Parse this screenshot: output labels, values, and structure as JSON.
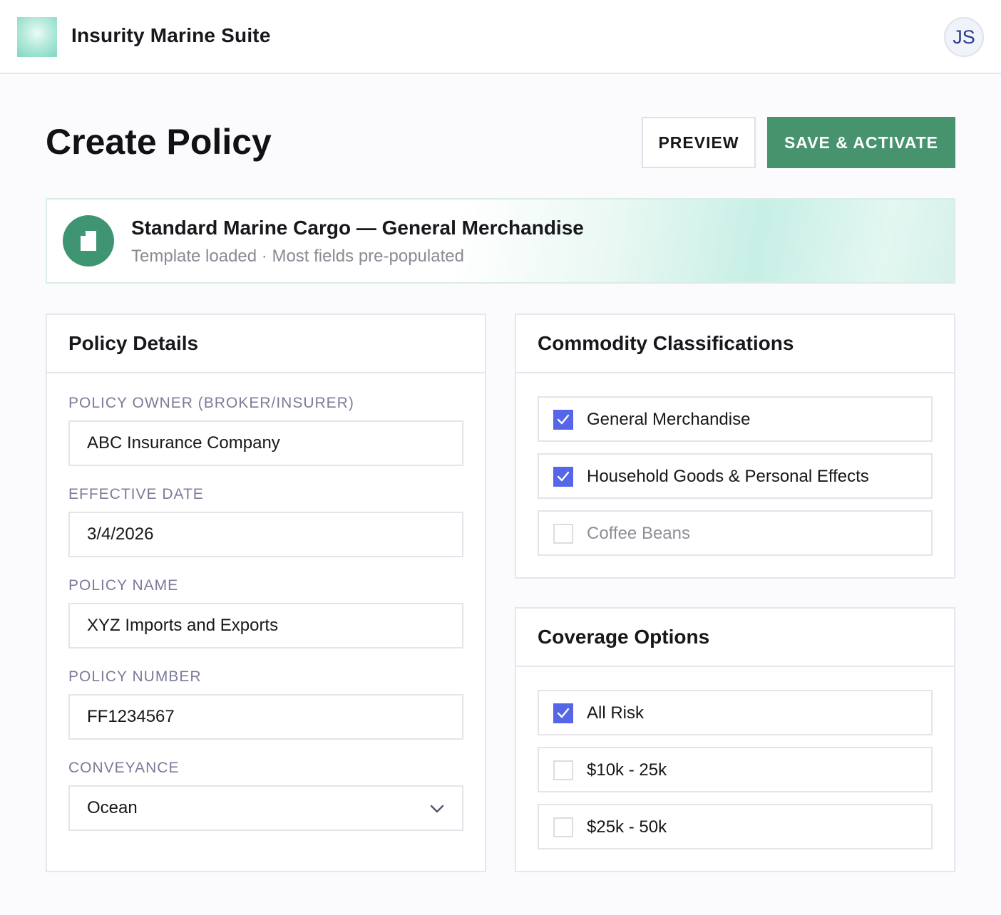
{
  "app": {
    "title": "Insurity Marine Suite",
    "user_initials": "JS"
  },
  "page": {
    "title": "Create Policy",
    "preview_label": "PREVIEW",
    "save_label": "SAVE & ACTIVATE"
  },
  "banner": {
    "title": "Standard Marine Cargo — General Merchandise",
    "subtitle": "Template loaded · Most fields pre-populated",
    "icon": "document-icon"
  },
  "policy_details": {
    "title": "Policy Details",
    "fields": [
      {
        "label": "POLICY OWNER (BROKER/INSURER)",
        "value": "ABC Insurance Company"
      },
      {
        "label": "EFFECTIVE DATE",
        "value": "3/4/2026"
      },
      {
        "label": "POLICY NAME",
        "value": "XYZ Imports and Exports"
      },
      {
        "label": "POLICY NUMBER",
        "value": "FF1234567"
      },
      {
        "label": "CONVEYANCE",
        "value": "Ocean"
      }
    ]
  },
  "commodity": {
    "title": "Commodity Classifications",
    "items": [
      {
        "label": "General Merchandise",
        "checked": true
      },
      {
        "label": "Household Goods & Personal Effects",
        "checked": true
      },
      {
        "label": "Coffee Beans",
        "checked": false
      }
    ]
  },
  "coverage": {
    "title": "Coverage Options",
    "items": [
      {
        "label": "All Risk",
        "checked": true
      },
      {
        "label": "$10k - 25k",
        "checked": false
      },
      {
        "label": "$25k - 50k",
        "checked": false
      }
    ]
  },
  "colors": {
    "accent_green": "#46936e",
    "checkbox_blue": "#5567e8",
    "label_purple": "#7b7b9a"
  }
}
